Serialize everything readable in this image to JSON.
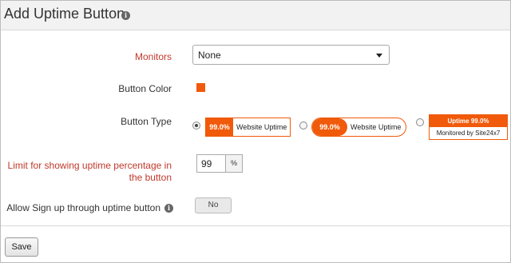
{
  "header": {
    "title": "Add Uptime Button"
  },
  "form": {
    "monitors": {
      "label": "Monitors",
      "value": "None"
    },
    "button_color": {
      "label": "Button Color",
      "color": "#f05a0a"
    },
    "button_type": {
      "label": "Button Type",
      "options": [
        {
          "pct": "99.0%",
          "text": "Website Uptime",
          "checked": true
        },
        {
          "pct": "99.0%",
          "text": "Website Uptime",
          "checked": false
        },
        {
          "top": "Uptime 99.0%",
          "bottom": "Monitored by Site24x7",
          "checked": false
        }
      ]
    },
    "limit": {
      "label_line1": "Limit for showing uptime percentage in",
      "label_line2": "the button",
      "value": "99",
      "unit": "%"
    },
    "signup": {
      "label": "Allow Sign up through uptime button",
      "toggle": "No"
    }
  },
  "footer": {
    "save_label": "Save"
  },
  "colors": {
    "accent": "#f05a0a",
    "required_label": "#c0392b"
  },
  "icons": [
    "info-icon",
    "dropdown-arrow-icon"
  ]
}
